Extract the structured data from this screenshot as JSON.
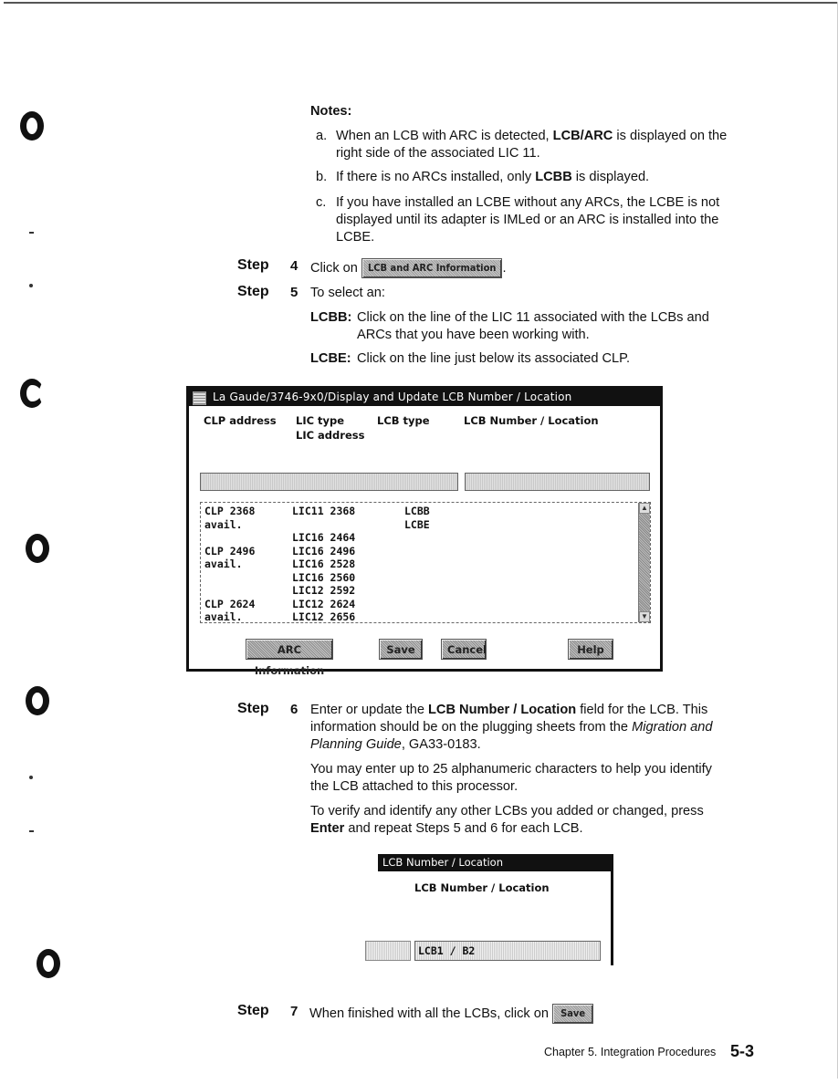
{
  "notes": {
    "heading": "Notes:",
    "a_marker": "a.",
    "a_text_1": "When an LCB with ARC is detected, ",
    "a_bold": "LCB/ARC",
    "a_text_2": " is displayed on the",
    "a_text_3": "right side of the associated LIC 11.",
    "b_marker": "b.",
    "b_text_1": "If there is no ARCs installed, only ",
    "b_bold": "LCBB",
    "b_text_2": " is displayed.",
    "c_marker": "c.",
    "c_line_1": "If you have installed an LCBE without any ARCs, the LCBE is not",
    "c_line_2": "displayed until its adapter is IMLed or an ARC is installed into the",
    "c_line_3": "LCBE."
  },
  "steps": {
    "label": "Step",
    "step4": {
      "num": "4",
      "text": "Click on",
      "button": "LCB and ARC Information",
      "suffix": "."
    },
    "step5": {
      "num": "5",
      "text": "To select an:",
      "lcbb_term": "LCBB:",
      "lcbb_line_1": "Click on the line of the LIC 11 associated with the LCBs and",
      "lcbb_line_2": "ARCs that you have been working with.",
      "lcbe_term": "LCBE:",
      "lcbe_line_1": "Click on the line just below its associated CLP."
    },
    "step6": {
      "num": "6",
      "p1_a": "Enter or update the ",
      "p1_bold": "LCB Number / Location",
      "p1_b": " field for the LCB.  This",
      "p1_line2_a": "information should be on the plugging sheets from the ",
      "p1_line2_italic": "Migration and",
      "p1_line3_italic": "Planning Guide",
      "p1_line3_b": ", GA33-0183.",
      "p2_line1": "You may enter up to 25 alphanumeric characters to help you identify",
      "p2_line2": "the LCB attached to this processor.",
      "p3_line1": "To verify and identify any other LCBs you added or changed, press",
      "p3_bold": "Enter",
      "p3_line2": " and repeat Steps 5 and 6 for each LCB."
    },
    "step7": {
      "num": "7",
      "text": "When finished with all the LCBs, click on",
      "button": "Save"
    }
  },
  "window": {
    "title": "La Gaude/3746-9x0/Display and Update LCB Number / Location",
    "headers": {
      "clp": "CLP address",
      "lic_type": "LIC type",
      "lic_address": "LIC address",
      "lcb_type": "LCB type",
      "lcb_loc": "LCB Number / Location"
    },
    "rows": [
      {
        "clp": "CLP 2368",
        "lic": "LIC11 2368",
        "lcb": "LCBB"
      },
      {
        "clp": "avail.",
        "lic": "",
        "lcb": "LCBE"
      },
      {
        "clp": "",
        "lic": "LIC16 2464",
        "lcb": ""
      },
      {
        "clp": "CLP 2496",
        "lic": "LIC16 2496",
        "lcb": ""
      },
      {
        "clp": "avail.",
        "lic": "LIC16 2528",
        "lcb": ""
      },
      {
        "clp": "",
        "lic": "LIC16 2560",
        "lcb": ""
      },
      {
        "clp": "",
        "lic": "LIC12 2592",
        "lcb": ""
      },
      {
        "clp": "CLP 2624",
        "lic": "LIC12 2624",
        "lcb": ""
      },
      {
        "clp": "avail.",
        "lic": "LIC12 2656",
        "lcb": ""
      }
    ],
    "buttons": {
      "arc": "ARC Information",
      "save": "Save",
      "cancel": "Cancel",
      "help": "Help"
    },
    "scroll_up": "▲",
    "scroll_down": "▼"
  },
  "dialog": {
    "title": "LCB Number / Location",
    "label": "LCB Number / Location",
    "value": "LCB1 / B2"
  },
  "footer": {
    "chapter": "Chapter 5.  Integration Procedures",
    "page": "5-3"
  }
}
